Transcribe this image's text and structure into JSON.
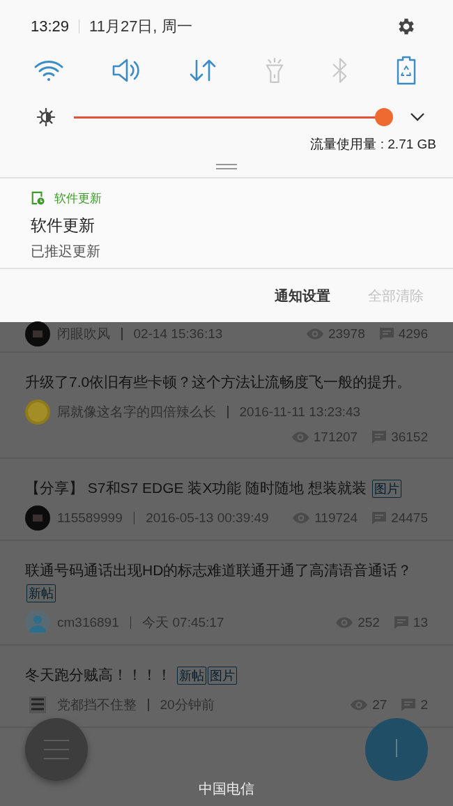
{
  "status": {
    "time": "13:29",
    "date": "11月27日, 周一"
  },
  "toggles": [
    {
      "kind": "wifi",
      "on": true
    },
    {
      "kind": "sound",
      "on": true
    },
    {
      "kind": "data",
      "on": true
    },
    {
      "kind": "flashlight",
      "on": false
    },
    {
      "kind": "bluetooth",
      "on": false
    },
    {
      "kind": "battery",
      "on": true
    }
  ],
  "brightness": {
    "level": 0.98
  },
  "data_usage": "流量使用量 : 2.71 GB",
  "notification": {
    "app": "软件更新",
    "title": "软件更新",
    "text": "已推迟更新"
  },
  "actions": [
    {
      "label": "通知设置",
      "disabled": false
    },
    {
      "label": "全部清除",
      "disabled": true
    }
  ],
  "posts": [
    {
      "author": "闭眼吹风",
      "time": "02-14 15:36:13",
      "views": "23978",
      "comments": "4296"
    },
    {
      "title": "升级了7.0依旧有些卡顿？这个方法让流畅度飞一般的提升。",
      "author": "屌就像这名字的四倍辣么长",
      "time": "2016-11-11 13:23:43",
      "views": "171207",
      "comments": "36152"
    },
    {
      "title": "【分享】 S7和S7 EDGE 装X功能 随时随地 想装就装",
      "tags": [
        "图片"
      ],
      "author": "115589999",
      "time": "2016-05-13 00:39:49",
      "views": "119724",
      "comments": "24475"
    },
    {
      "title": "联通号码通话出现HD的标志难道联通开通了高清语音通话？",
      "tags": [
        "新帖"
      ],
      "author": "cm316891",
      "time": "今天 07:45:17",
      "views": "252",
      "comments": "13"
    },
    {
      "title": "冬天跑分贼高！！！！",
      "tags": [
        "新帖",
        "图片"
      ],
      "author": "党都挡不住整",
      "time": "20分钟前",
      "views": "27",
      "comments": "2"
    }
  ],
  "carrier": "中国电信"
}
